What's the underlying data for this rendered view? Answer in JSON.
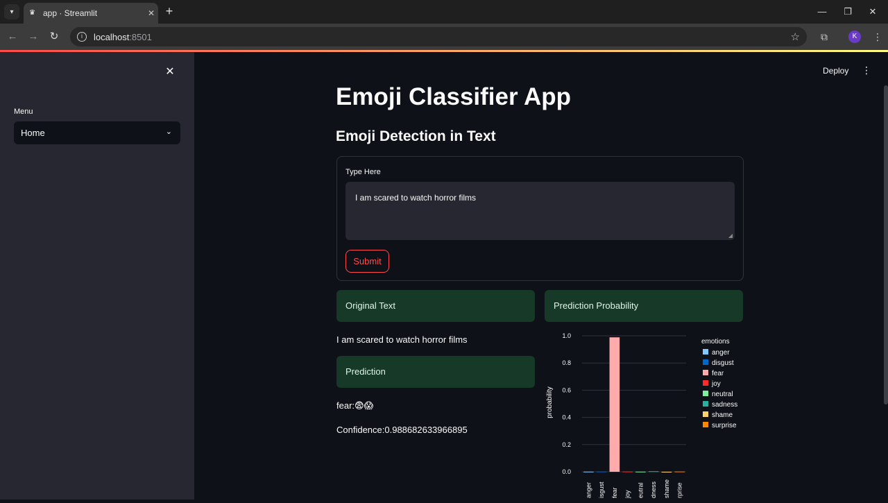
{
  "browser": {
    "tab_title": "app · Streamlit",
    "url_host": "localhost",
    "url_port": ":8501",
    "profile_initial": "K"
  },
  "sidebar": {
    "menu_label": "Menu",
    "menu_selected": "Home"
  },
  "header": {
    "deploy_label": "Deploy"
  },
  "main": {
    "title": "Emoji Classifier App",
    "subheader": "Emoji Detection in Text",
    "form": {
      "input_label": "Type Here",
      "input_value": "I am scared to watch horror films",
      "submit_label": "Submit"
    },
    "original_text_header": "Original Text",
    "original_text": "I am scared to watch horror films",
    "prediction_header": "Prediction",
    "prediction": "fear:😨😱",
    "confidence": "Confidence:0.988682633966895",
    "probability_header": "Prediction Probability"
  },
  "colors": {
    "accent": "#ff4b4b",
    "success_bg": "#173928",
    "background": "#0e1117",
    "sidebar": "#262730"
  },
  "chart_data": {
    "type": "bar",
    "categories": [
      "anger",
      "disgust",
      "fear",
      "joy",
      "neutral",
      "sadness",
      "shame",
      "surprise"
    ],
    "tick_labels_visible": [
      "anger",
      "isgust",
      "fear",
      "joy",
      "eutral",
      "dness",
      "shame",
      "rprise"
    ],
    "values": [
      0.001,
      0.002,
      0.9887,
      0.002,
      0.001,
      0.004,
      0.0,
      0.002
    ],
    "colors": [
      "#83c9ff",
      "#0068c9",
      "#ffabab",
      "#ff2b2b",
      "#7defa1",
      "#29b09d",
      "#ffd16a",
      "#ff8700"
    ],
    "ylabel": "probability",
    "xlabel": "",
    "ylim": [
      0,
      1.0
    ],
    "yticks": [
      "0.0",
      "0.2",
      "0.4",
      "0.6",
      "0.8",
      "1.0"
    ],
    "legend_title": "emotions",
    "legend_position": "right",
    "grid": true
  }
}
